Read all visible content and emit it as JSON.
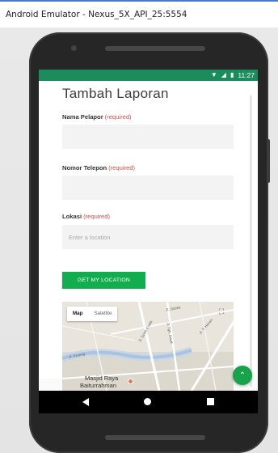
{
  "window": {
    "title": "Android Emulator - Nexus_5X_API_25:5554"
  },
  "statusbar": {
    "time": "11:27",
    "wifi_icon": "wifi-icon",
    "signal_icon": "signal-icon",
    "battery_icon": "battery-icon"
  },
  "form": {
    "title": "Tambah Laporan",
    "required_text": "(required)",
    "name_label": "Nama Pelapor",
    "name_value": "",
    "phone_label": "Nomor Telepon",
    "phone_value": "",
    "location_label": "Lokasi",
    "location_placeholder": "Enter a location",
    "location_value": "",
    "location_button": "GET MY LOCATION"
  },
  "map": {
    "tabs": [
      "Map",
      "Satellite"
    ],
    "active_tab": "Map",
    "place_label": "Masjid Raya Baiturrahman",
    "place_line1": "Masjid Raya",
    "place_line2": "Baiturrahman",
    "street_labels": [
      "Jl. Dahlia",
      "Jl. Syiah Kuala",
      "Jl. Tgk. Daud",
      "Jl. T. Hasan",
      "Jl. Krueng"
    ]
  },
  "colors": {
    "statusbar": "#1b8c5c",
    "button": "#12ad4e",
    "required": "#e44b4b",
    "fab": "#17a34a"
  }
}
